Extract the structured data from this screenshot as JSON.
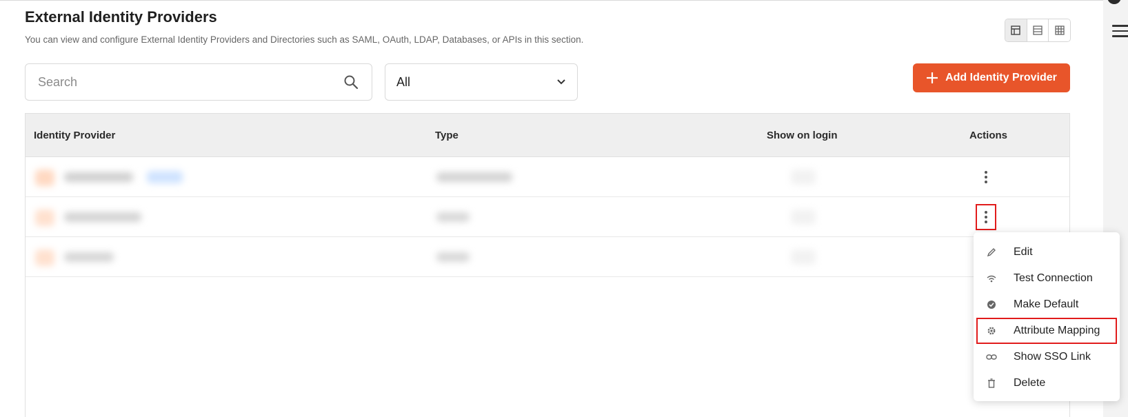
{
  "header": {
    "title": "External Identity Providers",
    "description": "You can view and configure External Identity Providers and Directories such as SAML, OAuth, LDAP, Databases, or APIs in this section."
  },
  "view_toggle": {
    "options": [
      "card-view-icon",
      "list-view-icon",
      "grid-view-icon"
    ],
    "active": "card-view-icon"
  },
  "search": {
    "placeholder": "Search",
    "value": ""
  },
  "filter": {
    "selected": "All"
  },
  "add_button": {
    "label": "Add Identity Provider",
    "color": "#e8552a"
  },
  "table": {
    "columns": [
      "Identity Provider",
      "Type",
      "Show on login",
      "Actions"
    ]
  },
  "actions_menu": {
    "items": [
      {
        "label": "Edit",
        "icon": "pencil-icon"
      },
      {
        "label": "Test Connection",
        "icon": "wifi-icon"
      },
      {
        "label": "Make Default",
        "icon": "check-circle-icon"
      },
      {
        "label": "Attribute Mapping",
        "icon": "gear-icon"
      },
      {
        "label": "Show SSO Link",
        "icon": "link-icon"
      },
      {
        "label": "Delete",
        "icon": "trash-icon"
      }
    ],
    "highlighted": "Attribute Mapping"
  },
  "colors": {
    "highlight": "#e11b1b",
    "accent": "#e8552a"
  }
}
